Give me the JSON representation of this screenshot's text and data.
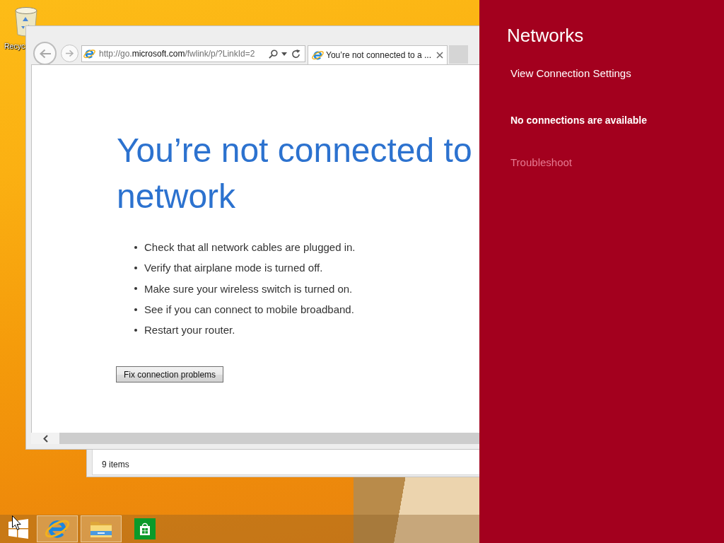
{
  "desktop_icons": [
    {
      "kind": "recycle_bin",
      "label": "Recyc"
    }
  ],
  "browser": {
    "address": "http://go.**microsoft.com**/fwlink/p/?LinkId=2",
    "tabs": [
      {
        "title": "You’re not connected to a ...",
        "selected": true
      }
    ],
    "page": {
      "heading": "You’re not connected to network",
      "tips": [
        "Check that all network cables are plugged in.",
        "Verify that airplane mode is turned off.",
        "Make sure your wireless switch is turned on.",
        "See if you can connect to mobile broadband.",
        "Restart your router."
      ],
      "button": "Fix connection problems"
    }
  },
  "explorer": {
    "status": "9 items"
  },
  "taskbar": {
    "items": [
      {
        "kind": "start",
        "running": false
      },
      {
        "kind": "browser",
        "running": true
      },
      {
        "kind": "folder",
        "running": true
      },
      {
        "kind": "store",
        "running": false
      }
    ]
  },
  "charm": {
    "title": "Networks",
    "settings_link": "View Connection Settings",
    "status": "No connections are available",
    "troubleshoot": {
      "label": "Troubleshoot",
      "disabled": true
    }
  }
}
